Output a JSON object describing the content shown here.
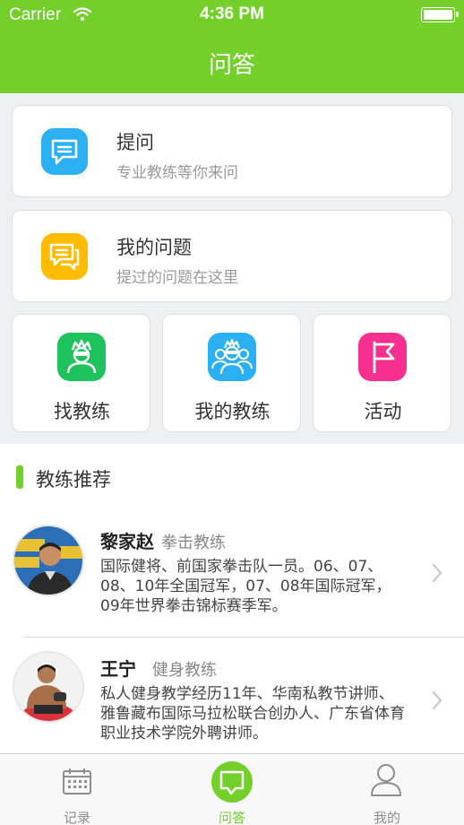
{
  "status_bar": {
    "carrier": "Carrier",
    "time": "4:36 PM"
  },
  "nav": {
    "title": "问答"
  },
  "ask": {
    "title": "提问",
    "subtitle": "专业教练等你来问",
    "icon": "chat-bubble-icon",
    "color": "#2bb1f3"
  },
  "my_questions": {
    "title": "我的问题",
    "subtitle": "提过的问题在这里",
    "icon": "chat-list-icon",
    "color": "#ffbb00"
  },
  "tiles": [
    {
      "label": "找教练",
      "icon": "coach-icon",
      "color": "#1ec35d"
    },
    {
      "label": "我的教练",
      "icon": "coaches-group-icon",
      "color": "#2bb1f3"
    },
    {
      "label": "活动",
      "icon": "flag-icon",
      "color": "#f72f8f"
    }
  ],
  "recommend": {
    "title": "教练推荐",
    "coaches": [
      {
        "name": "黎家赵",
        "role": "拳击教练",
        "desc": "国际健将、前国家拳击队一员。06、07、08、10年全国冠军，07、08年国际冠军，09年世界拳击锦标赛季军。"
      },
      {
        "name": "王宁",
        "role": "健身教练",
        "desc": "私人健身教学经历11年、华南私教节讲师、雅鲁藏布国际马拉松联合创办人、广东省体育职业技术学院外聘讲师。"
      }
    ]
  },
  "tabbar": {
    "items": [
      {
        "label": "记录",
        "icon": "calendar-icon"
      },
      {
        "label": "问答",
        "icon": "chat-bubble-icon",
        "active": true
      },
      {
        "label": "我的",
        "icon": "user-icon"
      }
    ]
  },
  "colors": {
    "brand": "#73d02a",
    "background": "#eef0f2"
  }
}
